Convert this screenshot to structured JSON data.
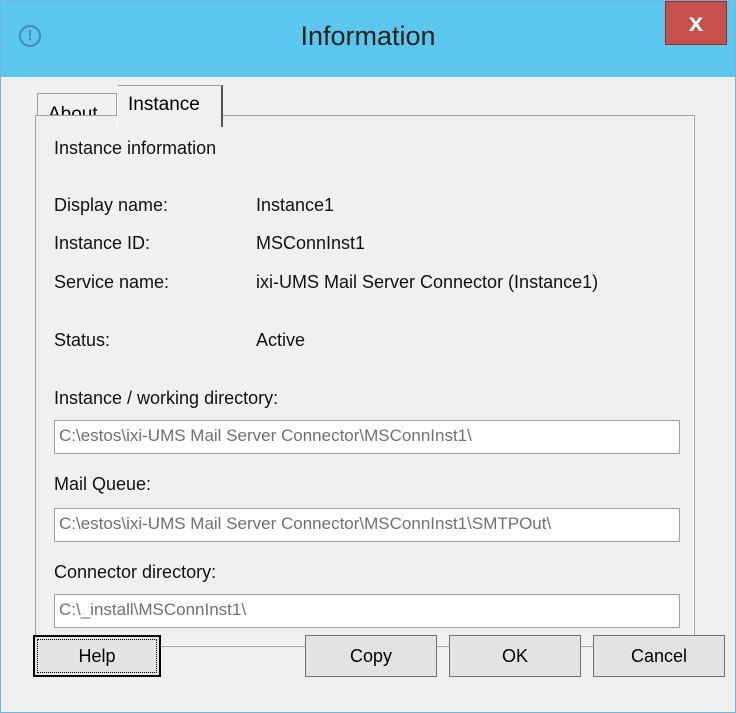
{
  "window": {
    "title": "Information",
    "title_icon": "info-icon",
    "close_label": "x"
  },
  "tabs": [
    {
      "label": "About",
      "selected": false
    },
    {
      "label": "Instance",
      "selected": true
    }
  ],
  "panel": {
    "heading": "Instance information",
    "rows": [
      {
        "label": "Display name:",
        "value": "Instance1"
      },
      {
        "label": "Instance ID:",
        "value": "MSConnInst1"
      },
      {
        "label": "Service name:",
        "value": "ixi-UMS Mail Server Connector (Instance1)"
      },
      {
        "label": "Status:",
        "value": "Active"
      }
    ],
    "fields": [
      {
        "label": "Instance / working directory:",
        "value": "C:\\estos\\ixi-UMS Mail Server Connector\\MSConnInst1\\"
      },
      {
        "label": "Mail Queue:",
        "value": "C:\\estos\\ixi-UMS Mail Server Connector\\MSConnInst1\\SMTPOut\\"
      },
      {
        "label": "Connector directory:",
        "value": "C:\\_install\\MSConnInst1\\"
      }
    ]
  },
  "buttons": {
    "help": "Help",
    "copy": "Copy",
    "ok": "OK",
    "cancel": "Cancel"
  },
  "colors": {
    "titlebar": "#5bc6ee",
    "close_button": "#c7504a"
  }
}
